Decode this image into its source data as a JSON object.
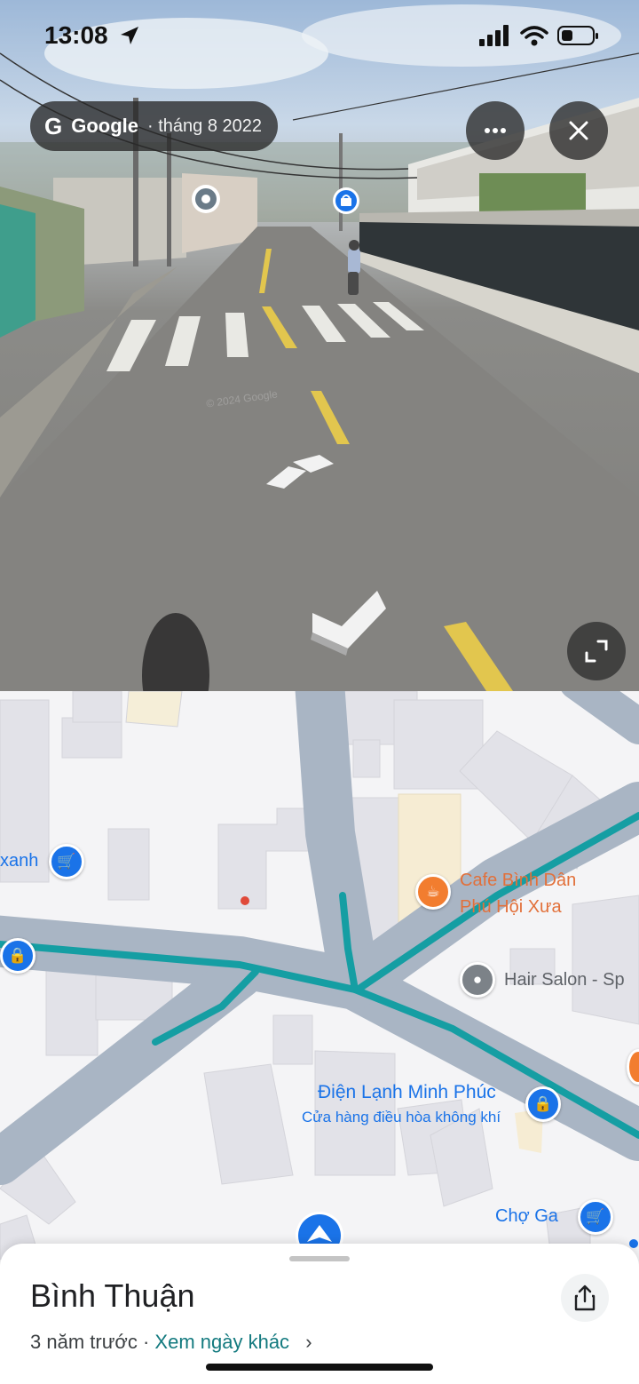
{
  "status_bar": {
    "time": "13:08"
  },
  "street_view": {
    "provider": "Google",
    "capture_date": "· tháng 8 2022",
    "watermark": "© 2024 Google",
    "icons": [
      "more-icon",
      "close-icon",
      "expand-icon"
    ]
  },
  "map": {
    "labels": {
      "shop_left": "xanh",
      "cafe_line1": "Cafe Bình Dân",
      "cafe_line2": "Phú Hội Xưa",
      "hair_salon": "Hair Salon - Sp",
      "shop_name": "Điện Lạnh Minh Phúc",
      "shop_category": "Cửa hàng điều hòa không khí",
      "market": "Chợ Ga"
    },
    "colors": {
      "road": "#a9b5c4",
      "route": "#16a3a8",
      "building": "#e1e1e6",
      "cafe_building": "#f7edd5"
    }
  },
  "sheet": {
    "title": "Bình Thuận",
    "age": "3 năm trước ·",
    "link": "Xem ngày khác",
    "chevron": "›"
  }
}
